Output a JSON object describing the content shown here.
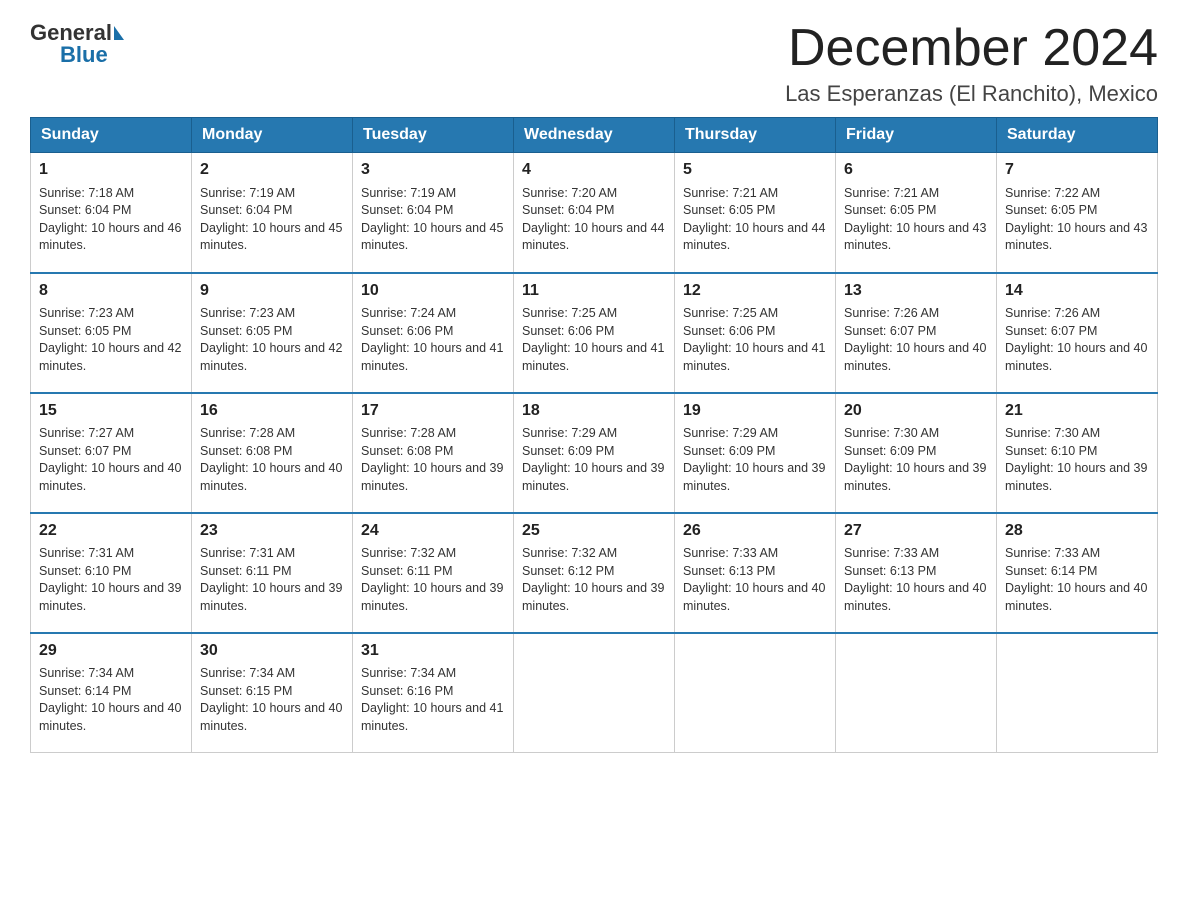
{
  "logo": {
    "general": "General",
    "blue": "Blue"
  },
  "title": "December 2024",
  "subtitle": "Las Esperanzas (El Ranchito), Mexico",
  "weekdays": [
    "Sunday",
    "Monday",
    "Tuesday",
    "Wednesday",
    "Thursday",
    "Friday",
    "Saturday"
  ],
  "weeks": [
    [
      {
        "day": "1",
        "sunrise": "Sunrise: 7:18 AM",
        "sunset": "Sunset: 6:04 PM",
        "daylight": "Daylight: 10 hours and 46 minutes."
      },
      {
        "day": "2",
        "sunrise": "Sunrise: 7:19 AM",
        "sunset": "Sunset: 6:04 PM",
        "daylight": "Daylight: 10 hours and 45 minutes."
      },
      {
        "day": "3",
        "sunrise": "Sunrise: 7:19 AM",
        "sunset": "Sunset: 6:04 PM",
        "daylight": "Daylight: 10 hours and 45 minutes."
      },
      {
        "day": "4",
        "sunrise": "Sunrise: 7:20 AM",
        "sunset": "Sunset: 6:04 PM",
        "daylight": "Daylight: 10 hours and 44 minutes."
      },
      {
        "day": "5",
        "sunrise": "Sunrise: 7:21 AM",
        "sunset": "Sunset: 6:05 PM",
        "daylight": "Daylight: 10 hours and 44 minutes."
      },
      {
        "day": "6",
        "sunrise": "Sunrise: 7:21 AM",
        "sunset": "Sunset: 6:05 PM",
        "daylight": "Daylight: 10 hours and 43 minutes."
      },
      {
        "day": "7",
        "sunrise": "Sunrise: 7:22 AM",
        "sunset": "Sunset: 6:05 PM",
        "daylight": "Daylight: 10 hours and 43 minutes."
      }
    ],
    [
      {
        "day": "8",
        "sunrise": "Sunrise: 7:23 AM",
        "sunset": "Sunset: 6:05 PM",
        "daylight": "Daylight: 10 hours and 42 minutes."
      },
      {
        "day": "9",
        "sunrise": "Sunrise: 7:23 AM",
        "sunset": "Sunset: 6:05 PM",
        "daylight": "Daylight: 10 hours and 42 minutes."
      },
      {
        "day": "10",
        "sunrise": "Sunrise: 7:24 AM",
        "sunset": "Sunset: 6:06 PM",
        "daylight": "Daylight: 10 hours and 41 minutes."
      },
      {
        "day": "11",
        "sunrise": "Sunrise: 7:25 AM",
        "sunset": "Sunset: 6:06 PM",
        "daylight": "Daylight: 10 hours and 41 minutes."
      },
      {
        "day": "12",
        "sunrise": "Sunrise: 7:25 AM",
        "sunset": "Sunset: 6:06 PM",
        "daylight": "Daylight: 10 hours and 41 minutes."
      },
      {
        "day": "13",
        "sunrise": "Sunrise: 7:26 AM",
        "sunset": "Sunset: 6:07 PM",
        "daylight": "Daylight: 10 hours and 40 minutes."
      },
      {
        "day": "14",
        "sunrise": "Sunrise: 7:26 AM",
        "sunset": "Sunset: 6:07 PM",
        "daylight": "Daylight: 10 hours and 40 minutes."
      }
    ],
    [
      {
        "day": "15",
        "sunrise": "Sunrise: 7:27 AM",
        "sunset": "Sunset: 6:07 PM",
        "daylight": "Daylight: 10 hours and 40 minutes."
      },
      {
        "day": "16",
        "sunrise": "Sunrise: 7:28 AM",
        "sunset": "Sunset: 6:08 PM",
        "daylight": "Daylight: 10 hours and 40 minutes."
      },
      {
        "day": "17",
        "sunrise": "Sunrise: 7:28 AM",
        "sunset": "Sunset: 6:08 PM",
        "daylight": "Daylight: 10 hours and 39 minutes."
      },
      {
        "day": "18",
        "sunrise": "Sunrise: 7:29 AM",
        "sunset": "Sunset: 6:09 PM",
        "daylight": "Daylight: 10 hours and 39 minutes."
      },
      {
        "day": "19",
        "sunrise": "Sunrise: 7:29 AM",
        "sunset": "Sunset: 6:09 PM",
        "daylight": "Daylight: 10 hours and 39 minutes."
      },
      {
        "day": "20",
        "sunrise": "Sunrise: 7:30 AM",
        "sunset": "Sunset: 6:09 PM",
        "daylight": "Daylight: 10 hours and 39 minutes."
      },
      {
        "day": "21",
        "sunrise": "Sunrise: 7:30 AM",
        "sunset": "Sunset: 6:10 PM",
        "daylight": "Daylight: 10 hours and 39 minutes."
      }
    ],
    [
      {
        "day": "22",
        "sunrise": "Sunrise: 7:31 AM",
        "sunset": "Sunset: 6:10 PM",
        "daylight": "Daylight: 10 hours and 39 minutes."
      },
      {
        "day": "23",
        "sunrise": "Sunrise: 7:31 AM",
        "sunset": "Sunset: 6:11 PM",
        "daylight": "Daylight: 10 hours and 39 minutes."
      },
      {
        "day": "24",
        "sunrise": "Sunrise: 7:32 AM",
        "sunset": "Sunset: 6:11 PM",
        "daylight": "Daylight: 10 hours and 39 minutes."
      },
      {
        "day": "25",
        "sunrise": "Sunrise: 7:32 AM",
        "sunset": "Sunset: 6:12 PM",
        "daylight": "Daylight: 10 hours and 39 minutes."
      },
      {
        "day": "26",
        "sunrise": "Sunrise: 7:33 AM",
        "sunset": "Sunset: 6:13 PM",
        "daylight": "Daylight: 10 hours and 40 minutes."
      },
      {
        "day": "27",
        "sunrise": "Sunrise: 7:33 AM",
        "sunset": "Sunset: 6:13 PM",
        "daylight": "Daylight: 10 hours and 40 minutes."
      },
      {
        "day": "28",
        "sunrise": "Sunrise: 7:33 AM",
        "sunset": "Sunset: 6:14 PM",
        "daylight": "Daylight: 10 hours and 40 minutes."
      }
    ],
    [
      {
        "day": "29",
        "sunrise": "Sunrise: 7:34 AM",
        "sunset": "Sunset: 6:14 PM",
        "daylight": "Daylight: 10 hours and 40 minutes."
      },
      {
        "day": "30",
        "sunrise": "Sunrise: 7:34 AM",
        "sunset": "Sunset: 6:15 PM",
        "daylight": "Daylight: 10 hours and 40 minutes."
      },
      {
        "day": "31",
        "sunrise": "Sunrise: 7:34 AM",
        "sunset": "Sunset: 6:16 PM",
        "daylight": "Daylight: 10 hours and 41 minutes."
      },
      null,
      null,
      null,
      null
    ]
  ]
}
